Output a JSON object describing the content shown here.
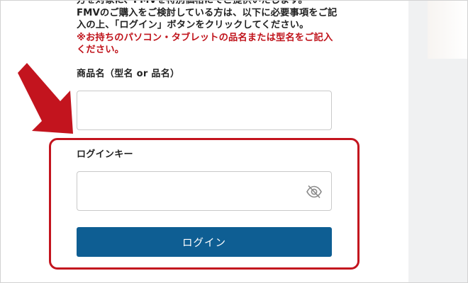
{
  "intro": {
    "line1": "方を対象に、FMVを特別価格にてご提供いたします。",
    "line2": "FMVのご購入をご検討している方は、以下に必要事項をご記",
    "line3": "入の上、「ログイン」ボタンをクリックしてください。",
    "note_line1": "※お持ちのパソコン・タブレットの品名または型名をご記入",
    "note_line2": "ください。"
  },
  "product_field": {
    "label": "商品名（型名 or 品名）",
    "value": "",
    "placeholder": ""
  },
  "login_key_field": {
    "label": "ログインキー",
    "value": "",
    "placeholder": "",
    "visibility_icon": "eye-slash-icon"
  },
  "login_button": {
    "label": "ログイン"
  },
  "colors": {
    "accent_red": "#c3141e",
    "button_blue": "#0e5e93",
    "note_red": "#c0141c"
  },
  "annotation": {
    "arrow_icon": "arrow-down-right-icon",
    "highlight": "red-rounded-highlight-box"
  }
}
